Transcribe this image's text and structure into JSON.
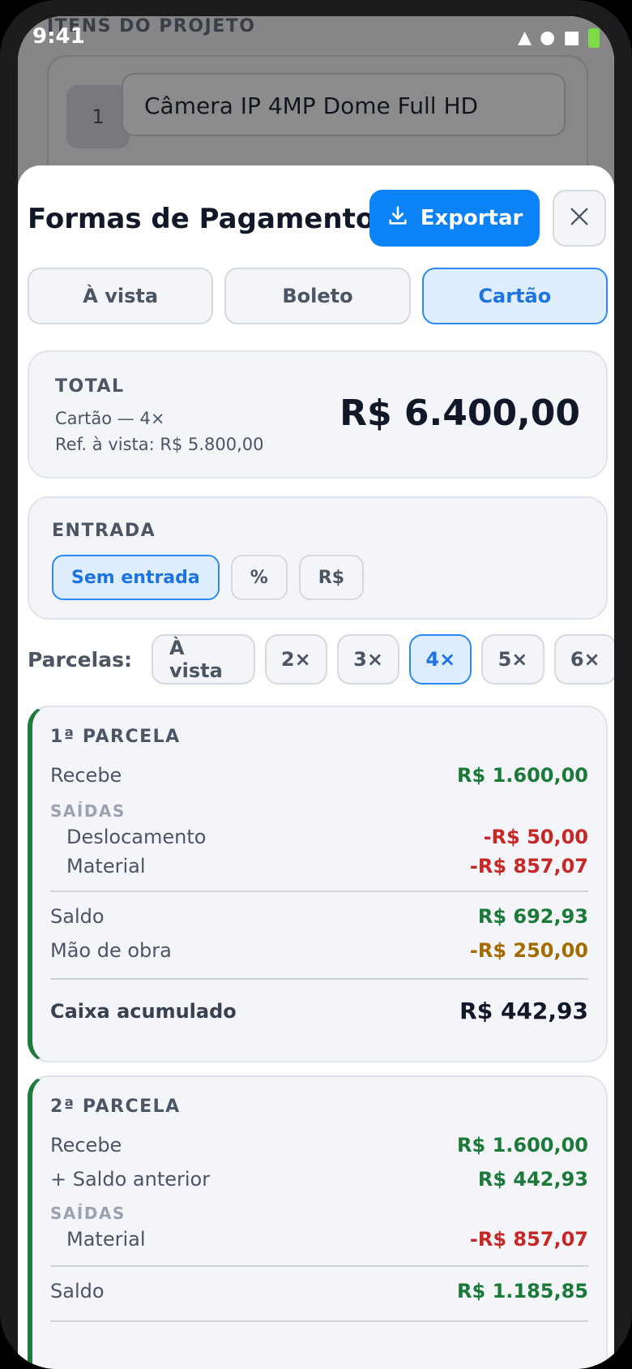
{
  "status_bar": {
    "time": "9:41"
  },
  "background": {
    "section_title": "ITENS DO PROJETO",
    "item_number": "1",
    "item_name": "Câmera IP 4MP Dome Full HD"
  },
  "sheet": {
    "title": "Formas de Pagamento",
    "export_label": "Exportar",
    "tabs": [
      {
        "label": "À vista",
        "active": false
      },
      {
        "label": "Boleto",
        "active": false
      },
      {
        "label": "Cartão",
        "active": true
      }
    ],
    "total": {
      "label": "TOTAL",
      "method": "Cartão — 4×",
      "reference": "Ref. à vista: R$ 5.800,00",
      "value": "R$ 6.400,00"
    },
    "entrada": {
      "label": "ENTRADA",
      "options": [
        {
          "label": "Sem entrada",
          "active": true
        },
        {
          "label": "%",
          "active": false
        },
        {
          "label": "R$",
          "active": false
        }
      ]
    },
    "parcelas": {
      "label": "Parcelas:",
      "options": [
        {
          "label": "À vista",
          "active": false
        },
        {
          "label": "2×",
          "active": false
        },
        {
          "label": "3×",
          "active": false
        },
        {
          "label": "4×",
          "active": true
        },
        {
          "label": "5×",
          "active": false
        },
        {
          "label": "6×",
          "active": false
        }
      ]
    },
    "installments": [
      {
        "title": "1ª PARCELA",
        "recebe_label": "Recebe",
        "recebe_value": "R$ 1.600,00",
        "saidas_label": "SAÍDAS",
        "saidas": [
          {
            "label": "Deslocamento",
            "value": "-R$ 50,00"
          },
          {
            "label": "Material",
            "value": "-R$ 857,07"
          }
        ],
        "saldo_label": "Saldo",
        "saldo_value": "R$ 692,93",
        "mao_label": "Mão de obra",
        "mao_value": "-R$ 250,00",
        "caixa_label": "Caixa acumulado",
        "caixa_value": "R$ 442,93"
      },
      {
        "title": "2ª PARCELA",
        "recebe_label": "Recebe",
        "recebe_value": "R$ 1.600,00",
        "anterior_label": "+ Saldo anterior",
        "anterior_value": "R$ 442,93",
        "saidas_label": "SAÍDAS",
        "saidas": [
          {
            "label": "Material",
            "value": "-R$ 857,07"
          }
        ],
        "saldo_label": "Saldo",
        "saldo_value": "R$ 1.185,85"
      }
    ]
  }
}
